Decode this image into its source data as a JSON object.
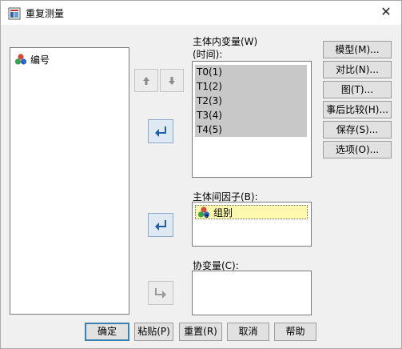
{
  "window": {
    "title": "重复测量",
    "close_glyph": "✕"
  },
  "source_list": {
    "items": [
      {
        "label": "编号",
        "icon": "nominal-variable-icon"
      }
    ]
  },
  "within_subjects": {
    "label": "主体内变量(W)",
    "sublabel": "(时间):",
    "items": [
      "T0(1)",
      "T1(2)",
      "T2(3)",
      "T3(4)",
      "T4(5)"
    ]
  },
  "between_factors": {
    "label": "主体间因子(B):",
    "items": [
      {
        "label": "组别",
        "icon": "nominal-variable-icon"
      }
    ]
  },
  "covariates": {
    "label": "协变量(C):",
    "items": []
  },
  "side_buttons": {
    "model": "模型(M)...",
    "contrast": "对比(N)...",
    "plots": "图(T)...",
    "posthoc": "事后比较(H)...",
    "save": "保存(S)...",
    "options": "选项(O)..."
  },
  "bottom_buttons": {
    "ok": "确定",
    "paste": "粘贴(P)",
    "reset": "重置(R)",
    "cancel": "取消",
    "help": "帮助"
  },
  "colors": {
    "accent": "#3c7fb1",
    "selected_highlight": "#fff9b0",
    "within_item_bg": "#c8c8c8",
    "arrow_blue": "#1f5fa8"
  }
}
